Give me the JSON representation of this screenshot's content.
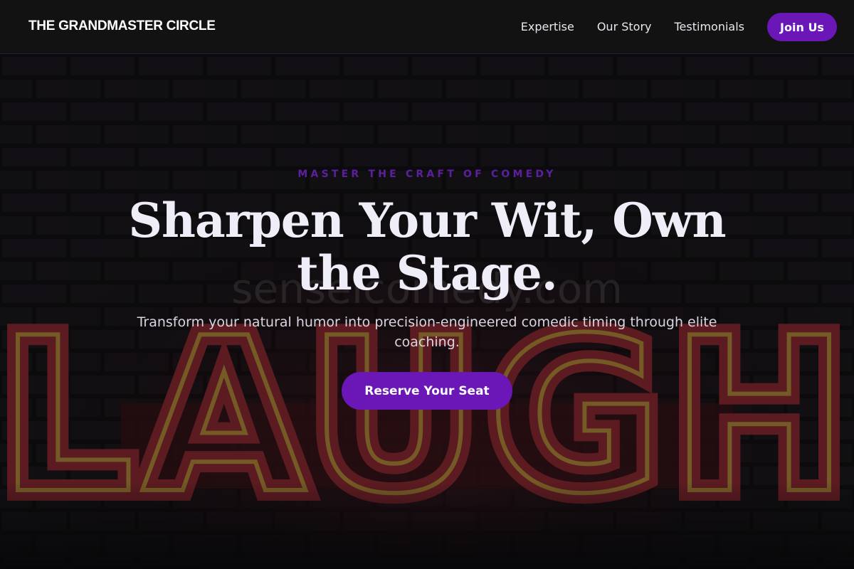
{
  "nav": {
    "brand": "THE GRANDMASTER CIRCLE",
    "links": [
      {
        "label": "Expertise"
      },
      {
        "label": "Our Story"
      },
      {
        "label": "Testimonials"
      }
    ],
    "cta_label": "Join Us"
  },
  "hero": {
    "eyebrow": "MASTER THE CRAFT OF COMEDY",
    "headline": "Sharpen Your Wit, Own the Stage.",
    "subtitle": "Transform your natural humor into precision-engineered comedic timing through elite coaching.",
    "cta_label": "Reserve Your Seat",
    "background_sign_text": "LAUGH",
    "watermark": "senseicomedy.com"
  },
  "colors": {
    "accent": "#6b17b8",
    "eyebrow": "#5c1f9f",
    "nav_bg": "#121212"
  }
}
